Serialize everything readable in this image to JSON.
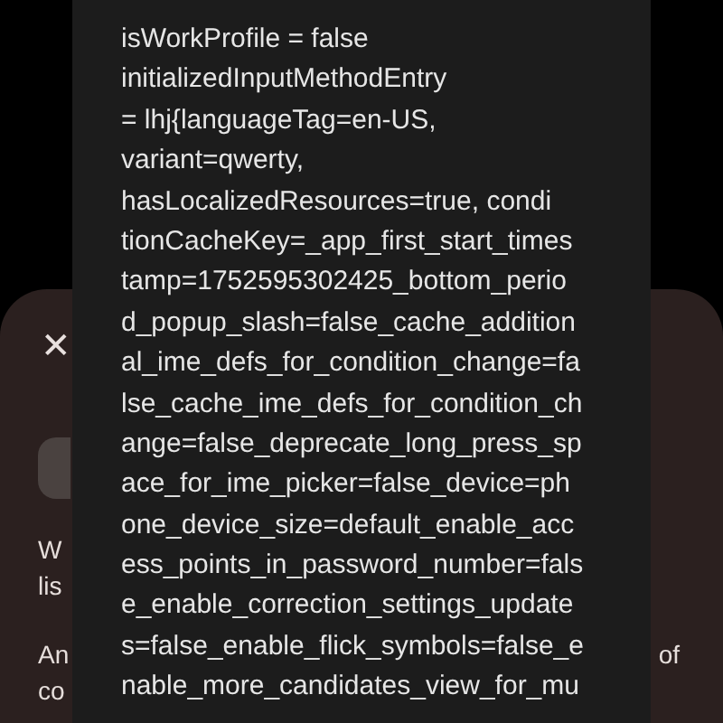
{
  "sheet": {
    "close": "✕",
    "text_fragments": [
      {
        "kind": "left",
        "text": "W"
      },
      {
        "kind": "left",
        "text": "lis"
      },
      {
        "kind": "split",
        "text": "An",
        "right": "of"
      },
      {
        "kind": "left",
        "text": "co"
      }
    ]
  },
  "overlay": {
    "lines": [
      "isWorkProfile = false",
      "initializedInputMethodEntry",
      "= lhj{languageTag=en-US,",
      "variant=qwerty,",
      "hasLocalizedResources=true, condi",
      "tionCacheKey=_app_first_start_times",
      "tamp=1752595302425_bottom_perio",
      "d_popup_slash=false_cache_addition",
      "al_ime_defs_for_condition_change=fa",
      "lse_cache_ime_defs_for_condition_ch",
      "ange=false_deprecate_long_press_sp",
      "ace_for_ime_picker=false_device=ph",
      "one_device_size=default_enable_acc",
      "ess_points_in_password_number=fals",
      "e_enable_correction_settings_update",
      "s=false_enable_flick_symbols=false_e",
      "nable_more_candidates_view_for_mu"
    ]
  }
}
